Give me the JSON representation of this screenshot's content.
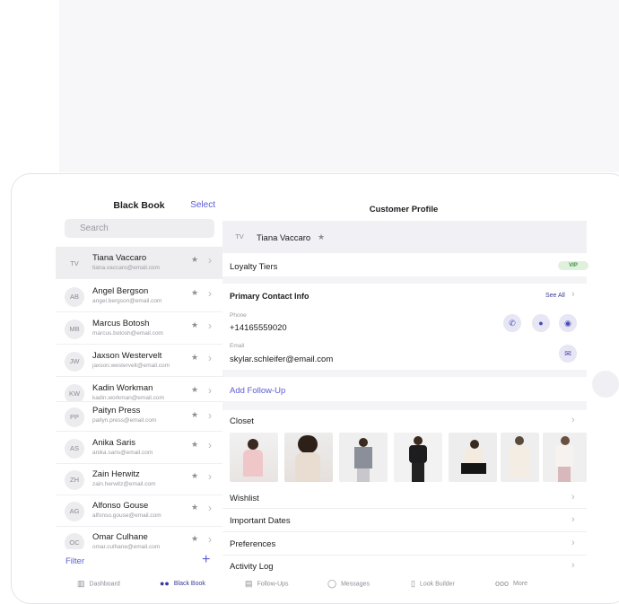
{
  "black_book": {
    "title": "Black Book",
    "select_label": "Select",
    "search_placeholder": "Search",
    "contacts": [
      {
        "initials": "TV",
        "name": "Tiana Vaccaro",
        "email": "tiana.vaccaro@email.com",
        "selected": true
      },
      {
        "initials": "AB",
        "name": "Angel Bergson",
        "email": "angel.bergson@email.com"
      },
      {
        "initials": "MB",
        "name": "Marcus Botosh",
        "email": "marcus.botosh@email.com"
      },
      {
        "initials": "JW",
        "name": "Jaxson Westervelt",
        "email": "jaxson.westervelt@email.com"
      },
      {
        "initials": "KW",
        "name": "Kadin Workman",
        "email": "kadin.workman@email.com"
      },
      {
        "initials": "PP",
        "name": "Paityn Press",
        "email": "paityn.press@email.com"
      },
      {
        "initials": "AS",
        "name": "Anika Saris",
        "email": "anika.saris@email.com"
      },
      {
        "initials": "ZH",
        "name": "Zain Herwitz",
        "email": "zain.herwitz@email.com"
      },
      {
        "initials": "AG",
        "name": "Alfonso Gouse",
        "email": "alfonso.gouse@email.com"
      },
      {
        "initials": "OC",
        "name": "Omar Culhane",
        "email": "omar.culhane@email.com"
      }
    ],
    "filter_label": "Filter",
    "add_symbol": "+"
  },
  "profile": {
    "title": "Customer Profile",
    "initials": "TV",
    "name": "Tiana Vaccaro",
    "star": "★",
    "loyalty_label": "Loyalty Tiers",
    "loyalty_badge": "VIP",
    "contact_header": "Primary Contact Info",
    "see_all": "See All",
    "phone_label": "Phone",
    "phone_value": "+14165559020",
    "email_label": "Email",
    "email_value": "skylar.schleifer@email.com",
    "add_follow_up": "Add Follow-Up",
    "closet_label": "Closet",
    "wishlist_label": "Wishlist",
    "important_dates_label": "Important Dates",
    "preferences_label": "Preferences",
    "activity_log_label": "Activity Log"
  },
  "tabbar": {
    "dashboard": "Dashboard",
    "black_book": "Black Book",
    "follow_ups": "Follow-Ups",
    "messages": "Messages",
    "look_builder": "Look Builder",
    "more": "More"
  },
  "colors": {
    "accent": "#5b5bd6",
    "vip_bg": "#dff1dd",
    "vip_text": "#3c8a3c"
  }
}
